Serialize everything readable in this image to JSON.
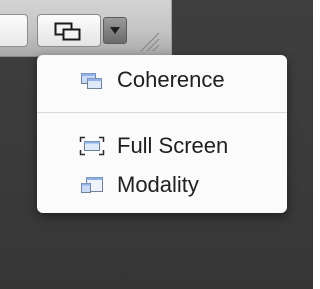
{
  "toolbar": {
    "view_mode_icon": "coherence-window-icon",
    "dropdown_icon": "triangle-down-icon"
  },
  "menu": {
    "items": [
      {
        "label": "Coherence",
        "icon": "coherence-icon"
      },
      {
        "label": "Full Screen",
        "icon": "full-screen-icon"
      },
      {
        "label": "Modality",
        "icon": "modality-icon"
      }
    ]
  },
  "colors": {
    "desktop": "#3c3c3c",
    "menu_background": "#fbfbfb",
    "menu_text": "#202020",
    "icon_blue": "#8fb2e8",
    "separator": "#d9d9d9"
  }
}
